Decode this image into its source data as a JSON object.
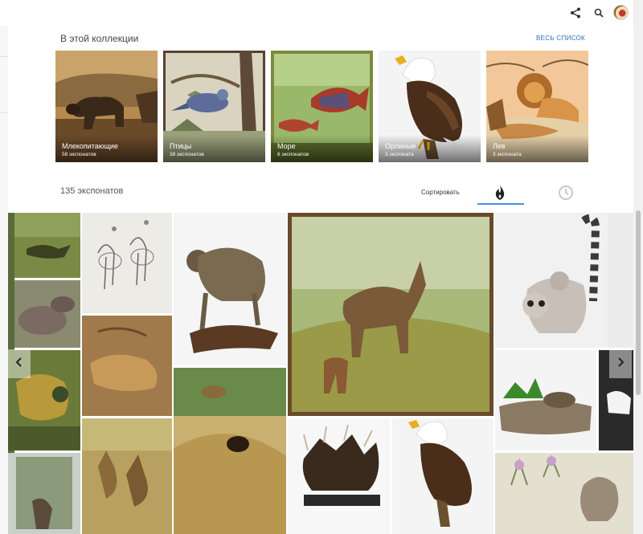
{
  "topbar": {
    "icons": [
      "share-icon",
      "search-icon",
      "avatar"
    ]
  },
  "collection": {
    "title": "В этой коллекции",
    "see_all": "ВЕСЬ СПИСОК",
    "items": [
      {
        "name": "Млекопитающие",
        "count": "58 экспонатов"
      },
      {
        "name": "Птицы",
        "count": "38 экспонатов"
      },
      {
        "name": "Море",
        "count": "6 экспонатов"
      },
      {
        "name": "Орлиные",
        "count": "3 экспоната"
      },
      {
        "name": "Лев",
        "count": "3 экспоната"
      }
    ]
  },
  "exhibits": {
    "count_label": "135 экспонатов",
    "sort_label": "Сортировать",
    "sort_options": [
      "flame-icon",
      "clock-icon"
    ]
  },
  "colors": {
    "accent": "#2a6ebb",
    "underline": "#4a90d9"
  }
}
